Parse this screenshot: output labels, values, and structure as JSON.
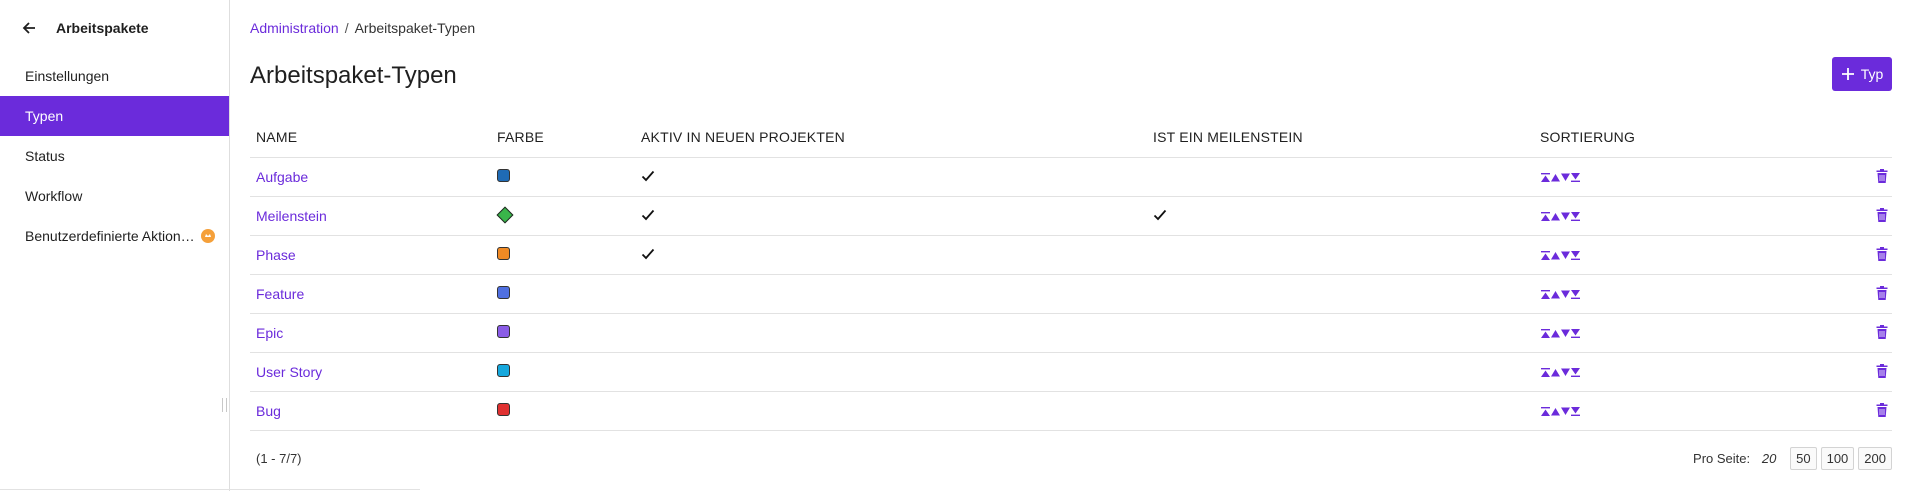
{
  "sidebar": {
    "title": "Arbeitspakete",
    "items": [
      {
        "label": "Einstellungen",
        "active": false
      },
      {
        "label": "Typen",
        "active": true
      },
      {
        "label": "Status",
        "active": false
      },
      {
        "label": "Workflow",
        "active": false
      },
      {
        "label": "Benutzerdefinierte Aktion…",
        "active": false,
        "badge": "enterprise-icon"
      }
    ]
  },
  "breadcrumb": {
    "parent": "Administration",
    "separator": "/",
    "current": "Arbeitspaket-Typen"
  },
  "page": {
    "title": "Arbeitspaket-Typen",
    "add_button_label": "Typ"
  },
  "table": {
    "columns": [
      "NAME",
      "FARBE",
      "AKTIV IN NEUEN PROJEKTEN",
      "IST EIN MEILENSTEIN",
      "SORTIERUNG"
    ],
    "rows": [
      {
        "name": "Aufgabe",
        "color": "#1f6bb5",
        "shape": "square",
        "active_new": true,
        "milestone": false
      },
      {
        "name": "Meilenstein",
        "color": "#39b54a",
        "shape": "diamond",
        "active_new": true,
        "milestone": true
      },
      {
        "name": "Phase",
        "color": "#f08a24",
        "shape": "square",
        "active_new": true,
        "milestone": false
      },
      {
        "name": "Feature",
        "color": "#4f6fe0",
        "shape": "square",
        "active_new": false,
        "milestone": false
      },
      {
        "name": "Epic",
        "color": "#8a5ce6",
        "shape": "square",
        "active_new": false,
        "milestone": false
      },
      {
        "name": "User Story",
        "color": "#16a8dd",
        "shape": "square",
        "active_new": false,
        "milestone": false
      },
      {
        "name": "Bug",
        "color": "#e03131",
        "shape": "square",
        "active_new": false,
        "milestone": false
      }
    ],
    "sort_icons": [
      "move-to-top-icon",
      "move-up-icon",
      "move-down-icon",
      "move-to-bottom-icon"
    ],
    "delete_icon": "trash-icon"
  },
  "footer": {
    "count": "(1 - 7/7)",
    "per_page_label": "Pro Seite:",
    "per_page_current": "20",
    "per_page_options": [
      "50",
      "100",
      "200"
    ]
  },
  "colors": {
    "accent": "#6b2bdb",
    "badge": "#f5a03a"
  }
}
